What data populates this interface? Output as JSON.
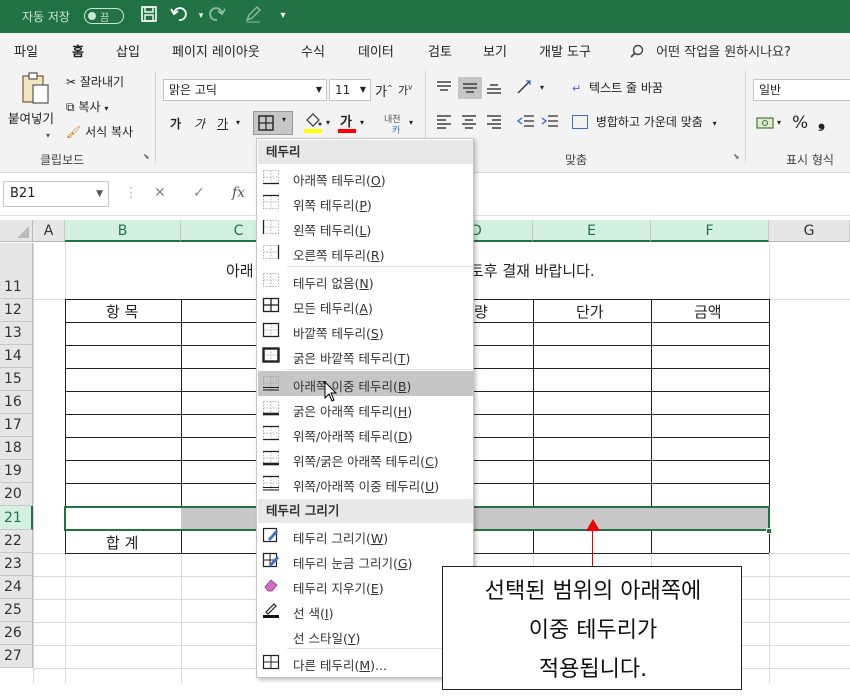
{
  "titlebar": {
    "autosave_label": "자동 저장",
    "toggle_state": "끔",
    "accent_color": "#217346"
  },
  "tabs": [
    {
      "label": "파일"
    },
    {
      "label": "홈"
    },
    {
      "label": "삽입"
    },
    {
      "label": "페이지 레이아웃"
    },
    {
      "label": "수식"
    },
    {
      "label": "데이터"
    },
    {
      "label": "검토"
    },
    {
      "label": "보기"
    },
    {
      "label": "개발 도구"
    }
  ],
  "tell_me": "어떤 작업을 원하시나요?",
  "clipboard": {
    "paste": "붙여넣기",
    "cut": "잘라내기",
    "copy": "복사",
    "format_painter": "서식 복사",
    "group_label": "클립보드"
  },
  "font": {
    "name": "맑은 고딕",
    "size": "11",
    "grow": "가",
    "shrink": "가",
    "bold": "가",
    "italic": "가",
    "underline": "가",
    "fill_color": "#ffff00",
    "font_color": "#ff0000",
    "font_color_glyph": "가",
    "phonetic": "내천"
  },
  "alignment": {
    "wrap_text": "텍스트 줄 바꿈",
    "merge_center": "병합하고 가운데 맞춤",
    "group_label": "맞춤"
  },
  "number": {
    "format": "일반",
    "group_label": "표시 형식",
    "percent": "%"
  },
  "formula_bar": {
    "name_box": "B21",
    "fx": "fx"
  },
  "grid": {
    "columns": [
      "A",
      "B",
      "C",
      "D",
      "E",
      "F",
      "G"
    ],
    "rows": [
      "11",
      "12",
      "13",
      "14",
      "15",
      "16",
      "17",
      "18",
      "19",
      "20",
      "21",
      "22",
      "23",
      "24",
      "25",
      "26",
      "27"
    ],
    "title_left": "아래",
    "title_right": "토후 결재 바랍니다.",
    "header_item": "항 목",
    "header_qty": "량",
    "header_price": "단가",
    "header_amount": "금액",
    "total_label": "합 계"
  },
  "menu": {
    "header_borders": "테두리",
    "header_draw": "테두리 그리기",
    "items": [
      {
        "label": "아래쪽 테두리",
        "key": "O"
      },
      {
        "label": "위쪽 테두리",
        "key": "P"
      },
      {
        "label": "왼쪽 테두리",
        "key": "L"
      },
      {
        "label": "오른쪽 테두리",
        "key": "R"
      },
      {
        "label": "테두리 없음",
        "key": "N"
      },
      {
        "label": "모든 테두리",
        "key": "A"
      },
      {
        "label": "바깥쪽 테두리",
        "key": "S"
      },
      {
        "label": "굵은 바깥쪽 테두리",
        "key": "T"
      },
      {
        "label": "아래쪽 이중 테두리",
        "key": "B"
      },
      {
        "label": "굵은 아래쪽 테두리",
        "key": "H"
      },
      {
        "label": "위쪽/아래쪽 테두리",
        "key": "D"
      },
      {
        "label": "위쪽/굵은 아래쪽 테두리",
        "key": "C"
      },
      {
        "label": "위쪽/아래쪽 이중 테두리",
        "key": "U"
      }
    ],
    "draw_items": [
      {
        "label": "테두리 그리기",
        "key": "W"
      },
      {
        "label": "테두리 눈금 그리기",
        "key": "G"
      },
      {
        "label": "테두리 지우기",
        "key": "E"
      },
      {
        "label": "선 색",
        "key": "I"
      },
      {
        "label": "선 스타일",
        "key": "Y"
      },
      {
        "label": "다른 테두리",
        "key": "M",
        "suffix": "..."
      }
    ]
  },
  "callout": {
    "line1": "선택된 범위의 아래쪽에",
    "line2": "이중 테두리가",
    "line3": "적용됩니다.",
    "arrow_color": "#e00000"
  }
}
